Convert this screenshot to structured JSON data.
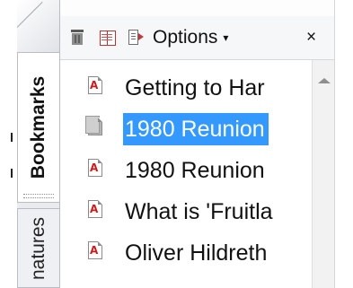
{
  "side_tabs": {
    "bookmarks": "Bookmarks",
    "signatures": "natures"
  },
  "toolbar": {
    "delete_icon": "trash-icon",
    "new_bookmark_icon": "bookmark-book-icon",
    "expand_icon": "expand-bookmark-icon",
    "options_label": "Options",
    "options_caret": "▾",
    "close_label": "×"
  },
  "bookmarks": [
    {
      "label": "Getting to Har",
      "icon": "pdf-icon",
      "selected": false
    },
    {
      "label": "1980 Reunion",
      "icon": "pdf-pages-icon",
      "selected": true
    },
    {
      "label": "1980 Reunion",
      "icon": "pdf-icon",
      "selected": false
    },
    {
      "label": "What is 'Fruitla",
      "icon": "pdf-icon",
      "selected": false
    },
    {
      "label": "Oliver Hildreth",
      "icon": "pdf-icon",
      "selected": false
    }
  ],
  "colors": {
    "selection": "#3399ff",
    "pdf_red": "#cc1b1b"
  }
}
